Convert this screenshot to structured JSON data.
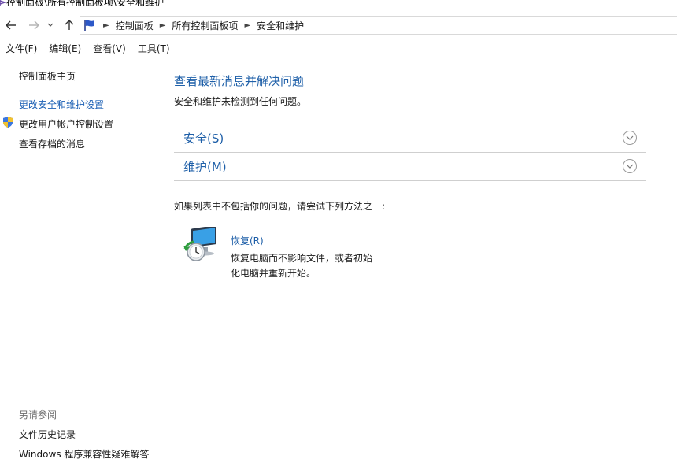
{
  "window": {
    "title": "控制面板\\所有控制面板项\\安全和维护"
  },
  "address_bar": {
    "breadcrumbs": [
      "控制面板",
      "所有控制面板项",
      "安全和维护"
    ]
  },
  "menu": {
    "items": [
      "文件(F)",
      "编辑(E)",
      "查看(V)",
      "工具(T)"
    ]
  },
  "sidebar": {
    "home": "控制面板主页",
    "links": [
      {
        "label": "更改安全和维护设置",
        "active": true,
        "icon": null
      },
      {
        "label": "更改用户帐户控制设置",
        "active": false,
        "icon": "uac-shield-icon"
      },
      {
        "label": "查看存档的消息",
        "active": false,
        "icon": null
      }
    ],
    "see_also_header": "另请参阅",
    "see_also": [
      "文件历史记录",
      "Windows 程序兼容性疑难解答"
    ]
  },
  "main": {
    "title": "查看最新消息并解决问题",
    "subtitle": "安全和维护未检测到任何问题。",
    "sections": [
      {
        "label": "安全(S)",
        "icon": "chevron-down-icon"
      },
      {
        "label": "维护(M)",
        "icon": "chevron-down-icon"
      }
    ],
    "hint": "如果列表中不包括你的问题，请尝试下列方法之一:",
    "recovery": {
      "link": "恢复(R)",
      "description": "恢复电脑而不影响文件，或者初始化电脑并重新开始。",
      "icon": "recovery-icon"
    }
  },
  "colors": {
    "link": "#1e5fa8",
    "active_link": "#1a5fb4",
    "muted": "#6d6d6d",
    "divider": "#cfcfcf"
  }
}
